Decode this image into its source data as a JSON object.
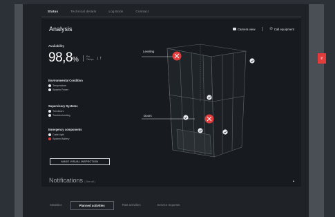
{
  "topnav": {
    "tabs": [
      "Status",
      "Technical details",
      "Log Book",
      "Contract"
    ],
    "active_index": 0
  },
  "header": {
    "title": "Analysis",
    "camera_view_label": "Camera view",
    "call_equipment_label": "Call equipment"
  },
  "availability": {
    "label": "Availability",
    "value": "98,8",
    "unit": "%",
    "meta_top": "Per",
    "meta_bottom": "Tiempo",
    "trend_icon": "↓↑"
  },
  "groups": [
    {
      "title": "Environmental Condition",
      "items": [
        {
          "label": "Temperature",
          "status": "ok"
        },
        {
          "label": "System Power",
          "status": "ok"
        }
      ]
    },
    {
      "title": "Supervisory Systems",
      "items": [
        {
          "label": "Trendbars",
          "status": "ok"
        },
        {
          "label": "Troubleshooting",
          "status": "ok"
        }
      ]
    },
    {
      "title": "Emergency components",
      "items": [
        {
          "label": "Cabin light",
          "status": "ok"
        },
        {
          "label": "System Battery",
          "status": "alert"
        }
      ]
    }
  ],
  "inspection_button_label": "MAKE VISUAL INSPECTION",
  "notifications": {
    "title": "Notifications",
    "see_all": "( See all )"
  },
  "model": {
    "callout_leveling": "Leveling",
    "callout_doors": "Doors"
  },
  "bottomtabs": {
    "tabs": [
      "Statistics",
      "Planned activities",
      "Past activities",
      "Service requests"
    ],
    "active_index": 1
  },
  "colors": {
    "accent_red": "#e23b3b",
    "background": "#171a1e"
  },
  "icons": [
    "camera-icon",
    "phone-icon",
    "check-icon",
    "close-icon",
    "chevron-up-icon"
  ]
}
